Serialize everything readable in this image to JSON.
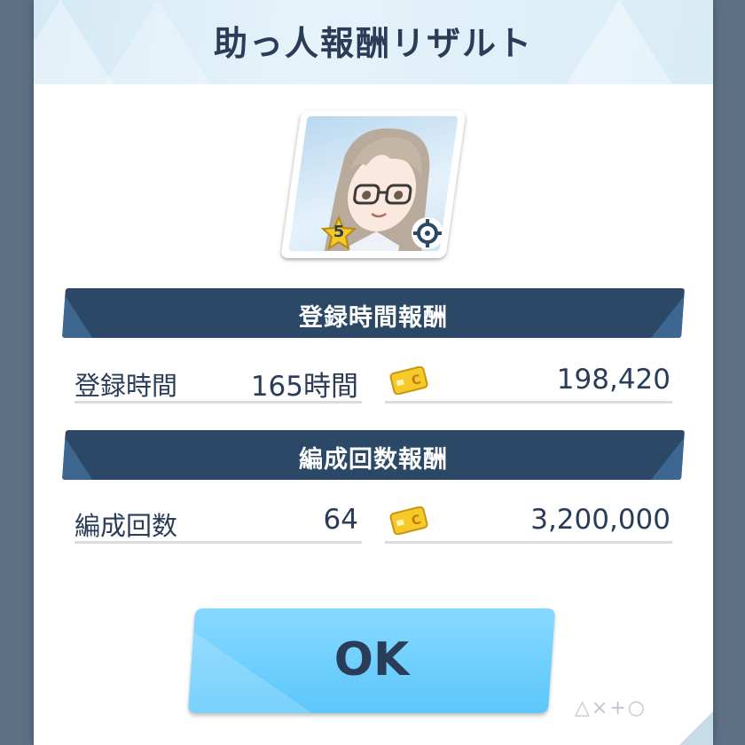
{
  "dialog": {
    "title": "助っ人報酬リザルト"
  },
  "character": {
    "rarity": "5",
    "rarity_icon": "star-icon",
    "type_icon": "crosshair-icon"
  },
  "sections": [
    {
      "title": "登録時間報酬",
      "label": "登録時間",
      "value": "165時間",
      "reward_icon": "coin-card-icon",
      "reward": "198,420"
    },
    {
      "title": "編成回数報酬",
      "label": "編成回数",
      "value": "64",
      "reward_icon": "coin-card-icon",
      "reward": "3,200,000"
    }
  ],
  "ok_button": {
    "label": "OK"
  },
  "footer": {
    "symbols": "△×+○"
  },
  "colors": {
    "title_text": "#2a3c57",
    "banner": "#2b4867",
    "button": "#6fd0fd",
    "coin": "#f4c928"
  }
}
